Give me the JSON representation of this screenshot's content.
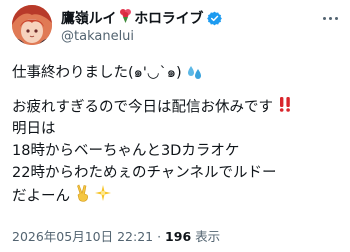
{
  "author": {
    "display_name": "鷹嶺ルイ",
    "suffix": "ホロライブ",
    "handle": "@takanelui"
  },
  "tweet": {
    "lines": [
      "仕事終わりました(๑'◡`๑)",
      "",
      "お疲れすぎるので今日は配信お休みです",
      "明日は",
      "18時からベーちゃんと3Dカラオケ",
      "22時からわためぇのチャンネルでルドー",
      "だよーん"
    ]
  },
  "meta": {
    "timestamp": "2026年05月10日 22:21",
    "separator": " · ",
    "views_count": "196",
    "views_label": "表示"
  },
  "icons": {
    "verified": "verified-badge-icon",
    "more": "more-options-icon",
    "emoji_bouquet": "bouquet-emoji-icon",
    "emoji_droplets": "sweat-droplets-emoji-icon",
    "emoji_double_exclaim": "double-exclamation-emoji-icon",
    "emoji_victory": "victory-hand-emoji-icon",
    "emoji_sparkle": "sparkle-emoji-icon"
  },
  "colors": {
    "verified_blue": "#1d9bf0",
    "text": "#0f1419",
    "secondary": "#536471",
    "exclaim_red": "#d9262c"
  }
}
